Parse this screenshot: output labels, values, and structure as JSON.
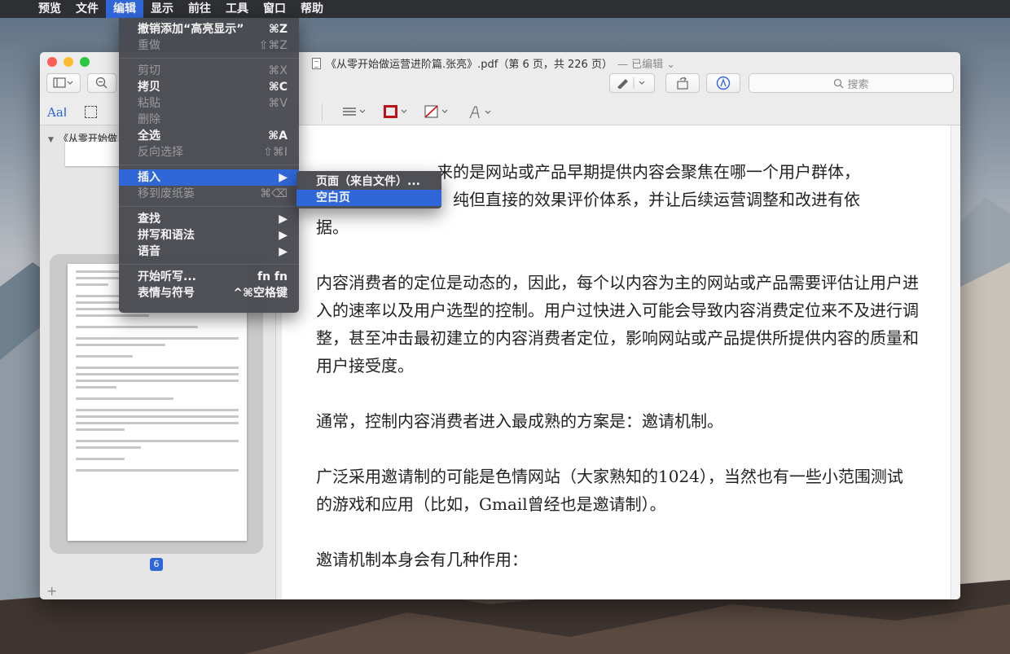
{
  "menubar": {
    "items": [
      "预览",
      "文件",
      "编辑",
      "显示",
      "前往",
      "工具",
      "窗口",
      "帮助"
    ]
  },
  "window": {
    "title": "《从零开始做运营进阶篇.张亮》.pdf（第 6 页，共 226 页）",
    "edited": "— 已编辑 ⌄",
    "search_placeholder": "搜索"
  },
  "edit_menu": {
    "items": [
      {
        "label": "撤销添加“高亮显示”",
        "shortcut": "⌘Z",
        "enabled": true
      },
      {
        "label": "重做",
        "shortcut": "⇧⌘Z",
        "enabled": false
      },
      {
        "label": "剪切",
        "shortcut": "⌘X",
        "enabled": false
      },
      {
        "label": "拷贝",
        "shortcut": "⌘C",
        "enabled": true
      },
      {
        "label": "粘贴",
        "shortcut": "⌘V",
        "enabled": false
      },
      {
        "label": "删除",
        "shortcut": "",
        "enabled": false
      },
      {
        "label": "全选",
        "shortcut": "⌘A",
        "enabled": true
      },
      {
        "label": "反向选择",
        "shortcut": "⇧⌘I",
        "enabled": false
      },
      {
        "label": "插入",
        "shortcut": "▶",
        "enabled": true
      },
      {
        "label": "移到废纸篓",
        "shortcut": "⌘⌫",
        "enabled": false
      },
      {
        "label": "查找",
        "shortcut": "▶",
        "enabled": true
      },
      {
        "label": "拼写和语法",
        "shortcut": "▶",
        "enabled": true
      },
      {
        "label": "语音",
        "shortcut": "▶",
        "enabled": true
      },
      {
        "label": "开始听写...",
        "shortcut": "fn fn",
        "enabled": true
      },
      {
        "label": "表情与符号",
        "shortcut": "^⌘空格键",
        "enabled": true
      }
    ]
  },
  "insert_submenu": {
    "items": [
      "页面（来自文件）...",
      "空白页"
    ]
  },
  "sidebar": {
    "title": "《从零开始做",
    "current_page": "6"
  },
  "document": {
    "paragraphs": [
      "来的是网站或产品早期提供内容会聚焦在哪一个用户群体，",
      "纯但直接的效果评价体系，并让后续运营调整和改进有依",
      "据。",
      "内容消费者的定位是动态的，因此，每个以内容为主的网站或产品需要评估让用户进入的速率以及用户选型的控制。用户过快进入可能会导致内容消费定位来不及进行调整，甚至冲击最初建立的内容消费者定位，影响网站或产品提供所提供内容的质量和用户接受度。",
      "通常，控制内容消费者进入最成熟的方案是：邀请机制。",
      "广泛采用邀请制的可能是色情网站（大家熟知的1024），当然也有一些小范围测试的游戏和应用（比如，Gmail曾经也是邀请制）。",
      "邀请机制本身会有几种作用："
    ]
  },
  "colors": {
    "accent": "#2f66d8",
    "menu_bg": "#484a50"
  }
}
